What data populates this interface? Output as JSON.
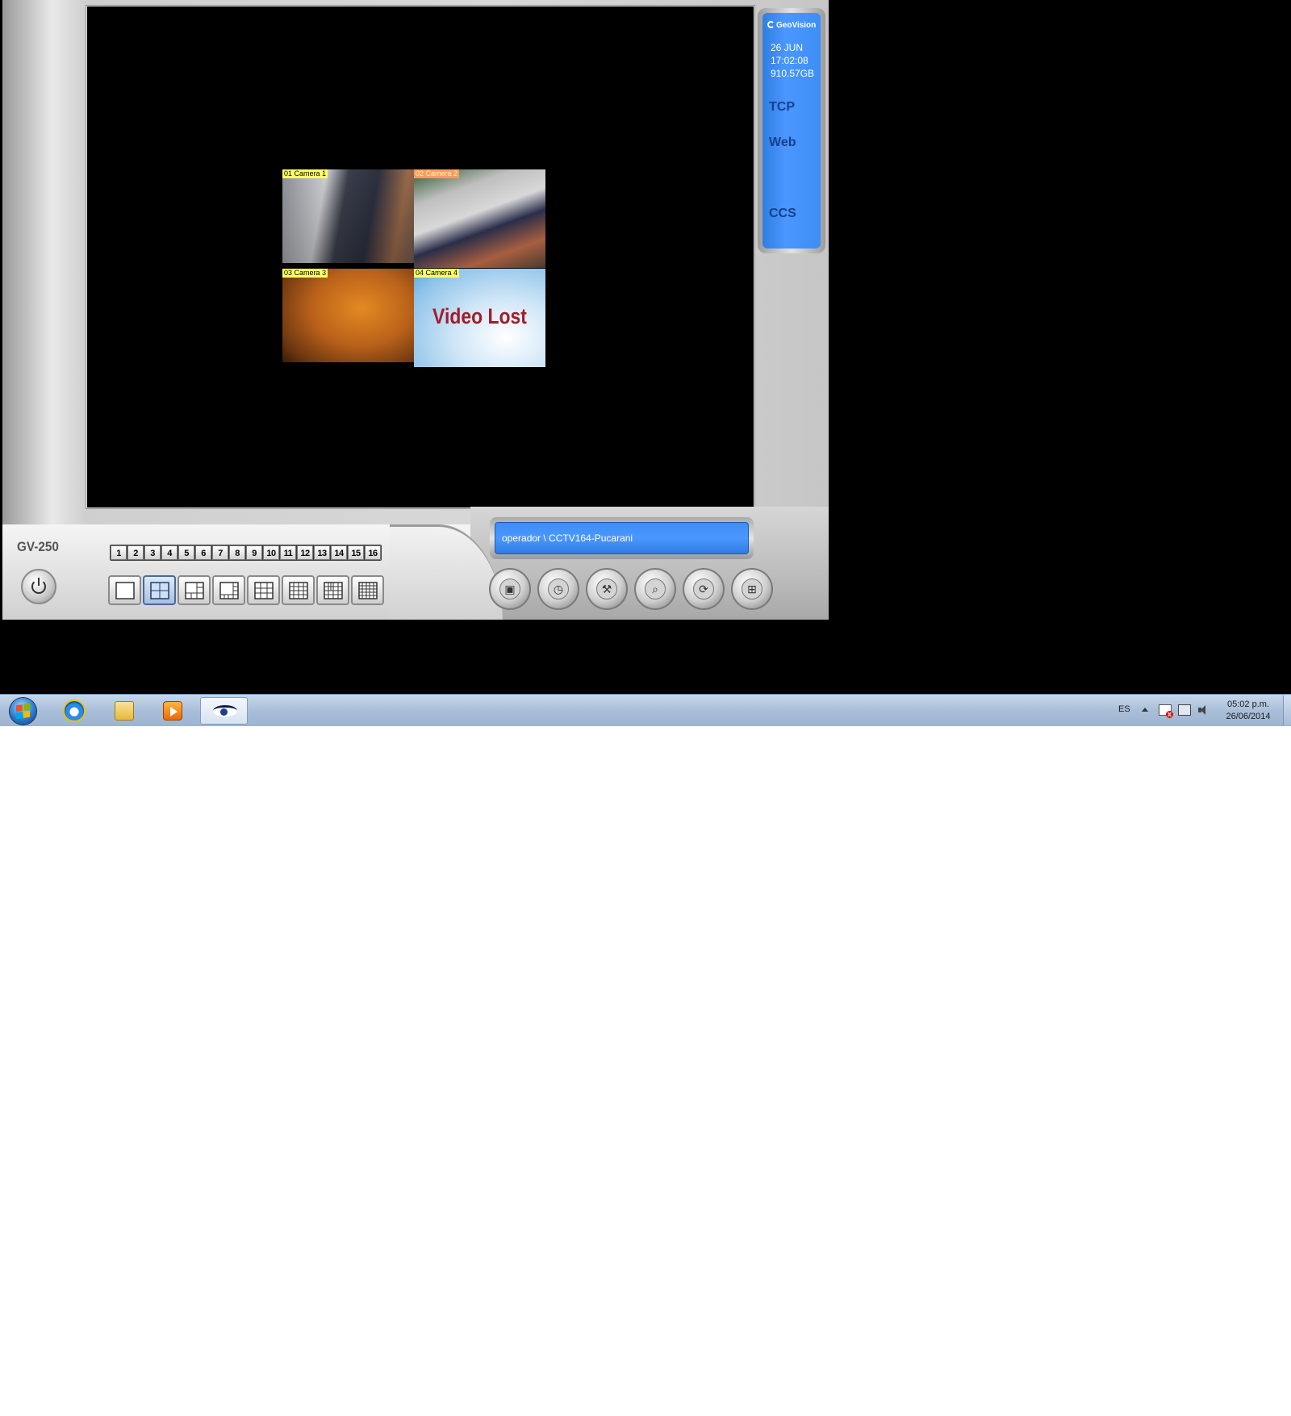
{
  "cameras": [
    {
      "label": "01 Camera 1"
    },
    {
      "label": "02 Camera 2"
    },
    {
      "label": "03 Camera 3"
    },
    {
      "label": "04 Camera 4",
      "overlay": "Video Lost"
    }
  ],
  "status": {
    "brand": "GeoVision",
    "date": "26 JUN",
    "time": "17:02:08",
    "disk": "910.57GB",
    "services": [
      "TCP",
      "Web",
      "CCS"
    ]
  },
  "model": "GV-250",
  "camera_numbers": [
    "1",
    "2",
    "3",
    "4",
    "5",
    "6",
    "7",
    "8",
    "9",
    "10",
    "11",
    "12",
    "13",
    "14",
    "15",
    "16"
  ],
  "layouts": [
    "1x1",
    "2x2",
    "1+5",
    "1+7",
    "3x3",
    "1+12",
    "4x4",
    "5x5"
  ],
  "active_layout": "2x2",
  "user_box": "operador \\ CCTV164-Pucarani",
  "tools": [
    "camera-config-icon",
    "schedule-icon",
    "tools-icon",
    "search-playback-icon",
    "network-icon",
    "remote-icon"
  ],
  "taskbar": {
    "apps": [
      "internet-explorer-icon",
      "windows-explorer-icon",
      "media-player-icon",
      "dvr-app-icon"
    ],
    "language": "ES",
    "clock_time": "05:02 p.m.",
    "clock_date": "26/06/2014"
  },
  "colors": {
    "panel_blue": "#4a97ff",
    "camera_label_bg": "#ffff66",
    "video_lost_text": "#a11d2a",
    "taskbar": "#a9bfd9"
  }
}
